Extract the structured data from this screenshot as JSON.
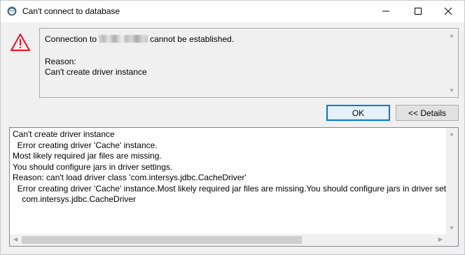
{
  "window": {
    "title": "Can't connect to database"
  },
  "message": {
    "line1_prefix": "Connection to",
    "line1_suffix": "cannot be established.",
    "reason_label": "Reason:",
    "reason_text": "Can't create driver instance"
  },
  "buttons": {
    "ok_label": "OK",
    "details_label": "<< Details"
  },
  "details": {
    "text": "Can't create driver instance\n  Error creating driver 'Cache' instance.\nMost likely required jar files are missing.\nYou should configure jars in driver settings.\nReason: can't load driver class 'com.intersys.jdbc.CacheDriver'\n  Error creating driver 'Cache' instance.Most likely required jar files are missing.You should configure jars in driver settings.\n    com.intersys.jdbc.CacheDriver"
  },
  "icons": {
    "app": "dbeaver-app-icon",
    "warning": "warning-triangle-icon",
    "minimize": "minimize-icon",
    "maximize": "maximize-icon",
    "close": "close-icon"
  },
  "colors": {
    "warning_red": "#e81123",
    "focus_blue": "#0078d7"
  }
}
